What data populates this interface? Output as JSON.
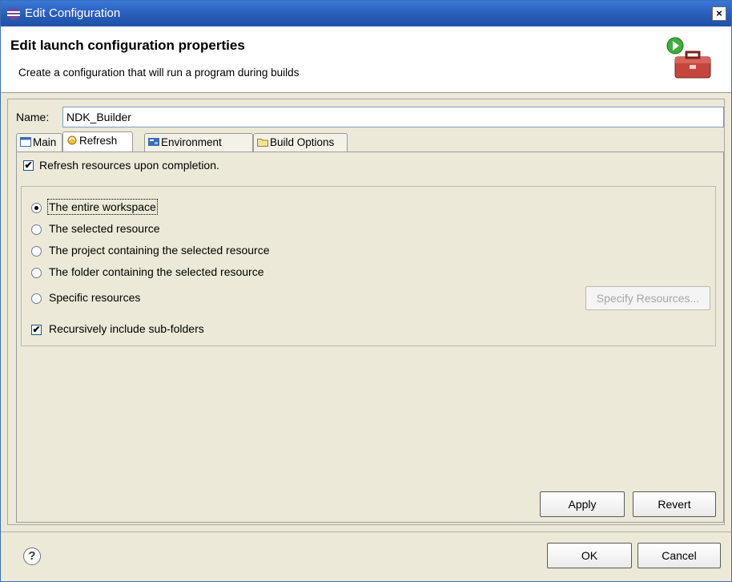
{
  "window": {
    "title": "Edit Configuration",
    "close_glyph": "×"
  },
  "header": {
    "title": "Edit launch configuration properties",
    "subtitle": "Create a configuration that will run a program during builds",
    "icon": "toolbox-run-icon"
  },
  "name_field": {
    "label": "Name:",
    "value": "NDK_Builder"
  },
  "tabs": [
    {
      "label": "Main",
      "icon": "main-tab-icon",
      "active": false
    },
    {
      "label": "Refresh",
      "icon": "refresh-tab-icon",
      "active": true
    },
    {
      "label": "Environment",
      "icon": "environment-tab-icon",
      "active": false
    },
    {
      "label": "Build Options",
      "icon": "build-options-tab-icon",
      "active": false
    }
  ],
  "refresh": {
    "refresh_upon_completion": {
      "label": "Refresh resources upon completion.",
      "checked": true
    },
    "scope_options": [
      {
        "label": "The entire workspace",
        "selected": true
      },
      {
        "label": "The selected resource",
        "selected": false
      },
      {
        "label": "The project containing the selected resource",
        "selected": false
      },
      {
        "label": "The folder containing the selected resource",
        "selected": false
      },
      {
        "label": "Specific resources",
        "selected": false
      }
    ],
    "specify_resources_button": "Specify Resources...",
    "recursive": {
      "label": "Recursively include sub-folders",
      "checked": true
    }
  },
  "buttons": {
    "apply": "Apply",
    "revert": "Revert",
    "ok": "OK",
    "cancel": "Cancel"
  },
  "help": {
    "glyph": "?"
  },
  "check_glyph": "✔"
}
